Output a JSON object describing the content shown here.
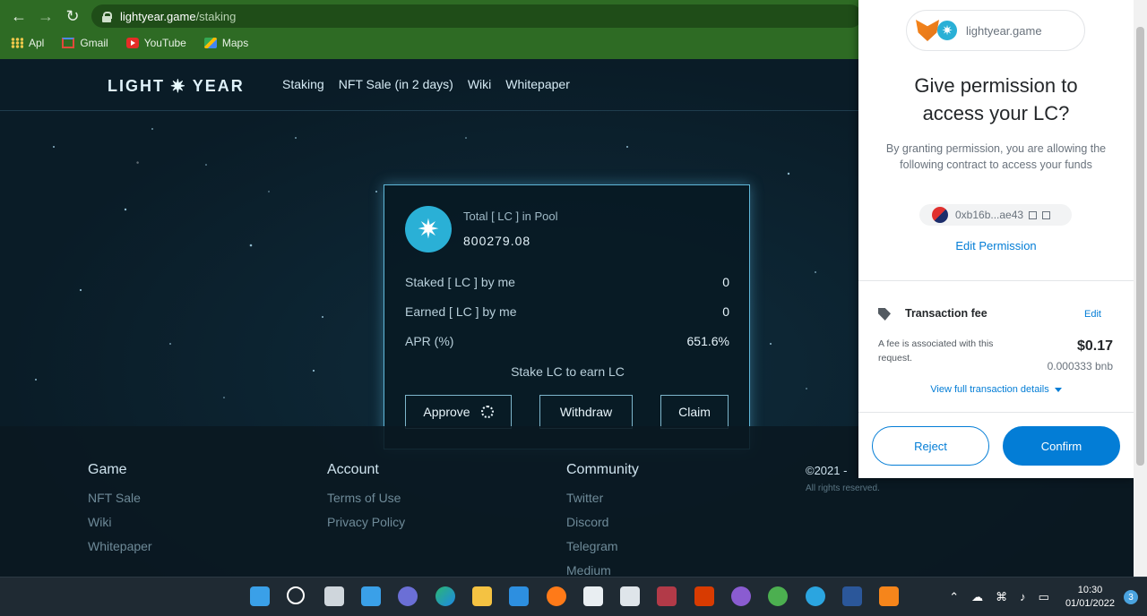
{
  "browser": {
    "url_host": "lightyear.game",
    "url_path": "/staking",
    "bookmarks": [
      "Apl",
      "Gmail",
      "YouTube",
      "Maps"
    ]
  },
  "site": {
    "logo_left": "LIGHT",
    "logo_star": "✷",
    "logo_right": "YEAR",
    "nav": [
      "Staking",
      "NFT Sale (in 2 days)",
      "Wiki",
      "Whitepaper"
    ]
  },
  "card": {
    "pool_label": "Total [ LC ] in Pool",
    "pool_value": "800279.08",
    "staked_label": "Staked [ LC ] by me",
    "staked_value": "0",
    "earned_label": "Earned [ LC ] by me",
    "earned_value": "0",
    "apr_label": "APR (%)",
    "apr_value": "651.6%",
    "hint": "Stake LC to earn LC",
    "approve": "Approve",
    "withdraw": "Withdraw",
    "claim": "Claim"
  },
  "footer": {
    "col1_title": "Game",
    "col1_links": [
      "NFT Sale",
      "Wiki",
      "Whitepaper"
    ],
    "col2_title": "Account",
    "col2_links": [
      "Terms of Use",
      "Privacy Policy"
    ],
    "col3_title": "Community",
    "col3_links": [
      "Twitter",
      "Discord",
      "Telegram",
      "Medium"
    ],
    "copyright": "©2021 -",
    "rights": "All rights reserved."
  },
  "metamask": {
    "origin": "lightyear.game",
    "title_line1": "Give permission to",
    "title_line2": "access your LC?",
    "description": "By granting permission, you are allowing the following contract to access your funds",
    "contract": "0xb16b...ae43",
    "edit_permission": "Edit Permission",
    "fee_title": "Transaction fee",
    "fee_edit": "Edit",
    "fee_desc": "A fee is associated with this request.",
    "fee_usd": "$0.17",
    "fee_bnb": "0.000333 bnb",
    "view_details": "View full transaction details",
    "reject": "Reject",
    "confirm": "Confirm"
  },
  "taskbar": {
    "time": "10:30",
    "date": "01/01/2022",
    "notifications": "3"
  }
}
